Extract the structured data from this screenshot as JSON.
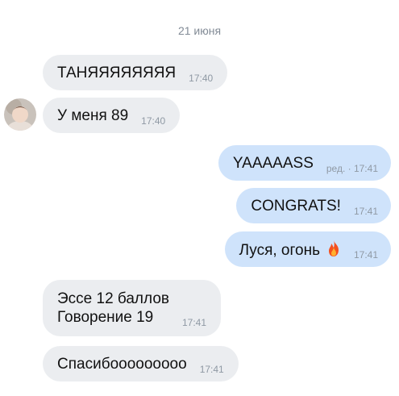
{
  "chat": {
    "date_separator": "21 июня",
    "messages": [
      {
        "text": "ТАНЯЯЯЯЯЯЯЯ",
        "time": "17:40"
      },
      {
        "text": "У меня 89",
        "time": "17:40"
      },
      {
        "text": "YAAAAASS",
        "time": "ред. · 17:41"
      },
      {
        "text": "CONGRATS!",
        "time": "17:41"
      },
      {
        "text": "Луся, огонь",
        "icon": "fire-emoji",
        "time": "17:41"
      },
      {
        "lines": [
          "Эссе 12 баллов",
          "Говорение 19"
        ],
        "time": "17:41"
      },
      {
        "text": "Спасибооооооооо",
        "time": "17:41"
      }
    ]
  },
  "colors": {
    "incoming_bubble": "#ebedf0",
    "outgoing_bubble": "#cfe3fb",
    "timestamp": "#8f99a4",
    "date_separator": "#828b96"
  }
}
